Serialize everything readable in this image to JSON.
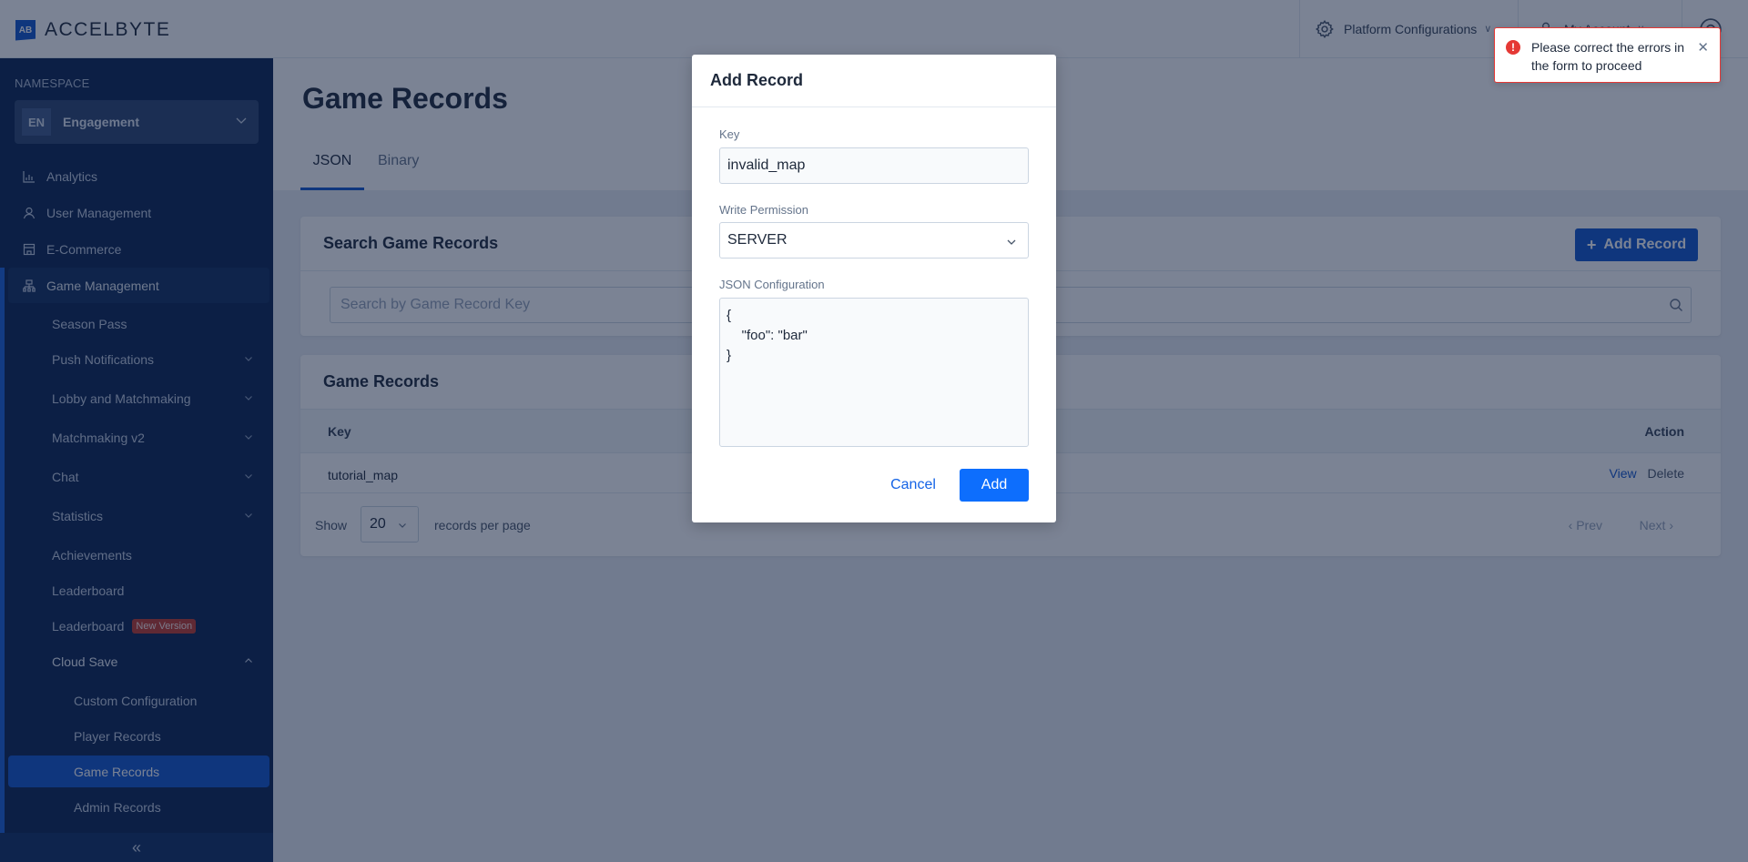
{
  "header": {
    "logo_mark": "AB",
    "logo_text": "ACCELBYTE",
    "platform_config": "Platform Configurations",
    "my_account": "My Account",
    "icons": {
      "platform": "gear-icon",
      "account": "user-icon",
      "help": "help-icon"
    }
  },
  "sidebar": {
    "namespace_label": "NAMESPACE",
    "namespace_badge": "EN",
    "namespace_name": "Engagement",
    "top_items": [
      {
        "label": "Analytics",
        "icon": "chart-icon"
      },
      {
        "label": "User Management",
        "icon": "user-icon"
      },
      {
        "label": "E-Commerce",
        "icon": "store-icon"
      },
      {
        "label": "Game Management",
        "icon": "hierarchy-icon"
      }
    ],
    "game_items": [
      {
        "label": "Season Pass"
      },
      {
        "label": "Push Notifications",
        "expandable": true
      },
      {
        "label": "Lobby and Matchmaking",
        "expandable": true
      },
      {
        "label": "Matchmaking v2",
        "expandable": true
      },
      {
        "label": "Chat",
        "expandable": true
      },
      {
        "label": "Statistics",
        "expandable": true
      },
      {
        "label": "Achievements"
      },
      {
        "label": "Leaderboard"
      },
      {
        "label": "Leaderboard",
        "badge": "New Version"
      },
      {
        "label": "Cloud Save",
        "expanded": true
      }
    ],
    "cloud_save_items": [
      {
        "label": "Custom Configuration"
      },
      {
        "label": "Player Records"
      },
      {
        "label": "Game Records",
        "active": true
      },
      {
        "label": "Admin Records"
      }
    ],
    "collapse_glyph": "«"
  },
  "main": {
    "title": "Game Records",
    "tabs": [
      {
        "label": "JSON",
        "active": true
      },
      {
        "label": "Binary",
        "active": false
      }
    ],
    "search_card": {
      "title": "Search Game Records",
      "add_button": "Add Record",
      "search_placeholder": "Search by Game Record Key"
    },
    "records_card": {
      "title": "Game Records",
      "columns": [
        "Key",
        "Action"
      ],
      "rows": [
        {
          "key": "tutorial_map",
          "actions": [
            "View",
            "Delete"
          ]
        }
      ],
      "pager": {
        "show_label": "Show",
        "per_page_value": "20",
        "per_page_label": "records per page",
        "prev": "‹ Prev",
        "next": "Next ›"
      }
    }
  },
  "modal": {
    "title": "Add Record",
    "key_label": "Key",
    "key_value": "invalid_map",
    "permission_label": "Write Permission",
    "permission_value": "SERVER",
    "json_label": "JSON Configuration",
    "json_value": "{\n    \"foo\": \"bar\"\n}",
    "cancel": "Cancel",
    "add": "Add"
  },
  "toast": {
    "type": "error",
    "message": "Please correct the errors in the form to proceed",
    "icon": "!"
  },
  "colors": {
    "brand": "#1155cc",
    "primary_button": "#0d6efd",
    "error": "#e53935",
    "sidebar_bg": "#0b2350"
  }
}
